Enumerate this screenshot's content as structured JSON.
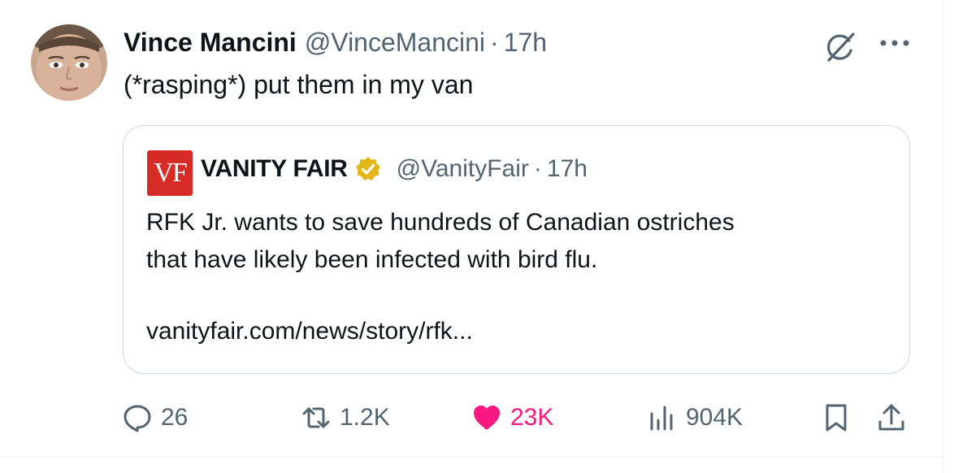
{
  "author": {
    "name": "Vince Mancini",
    "handle": "@VinceMancini",
    "separator": "·",
    "time": "17h"
  },
  "tweet_text": "(*rasping*) put them in my van",
  "quote": {
    "logo_text": "VF",
    "name": "VANITY FAIR",
    "handle": "@VanityFair",
    "separator": "·",
    "time": "17h",
    "text_lines": [
      "RFK Jr. wants to save hundreds of Canadian ostriches",
      "that have likely been infected with bird flu."
    ],
    "link": "vanityfair.com/news/story/rfk..."
  },
  "actions": {
    "replies": "26",
    "reposts": "1.2K",
    "likes": "23K",
    "views": "904K"
  },
  "icons": {
    "header": [
      "grok-icon",
      "more-icon"
    ],
    "actions": [
      "reply-icon",
      "retweet-icon",
      "heart-icon",
      "views-icon",
      "bookmark-icon",
      "share-icon"
    ],
    "badge": "verified-gold-badge-icon"
  },
  "colors": {
    "text_primary": "#0f1419",
    "text_secondary": "#536471",
    "like_active": "#f91880",
    "vf_red": "#d72b27",
    "verified_gold": "#e2b719",
    "border": "#cfd9de"
  }
}
